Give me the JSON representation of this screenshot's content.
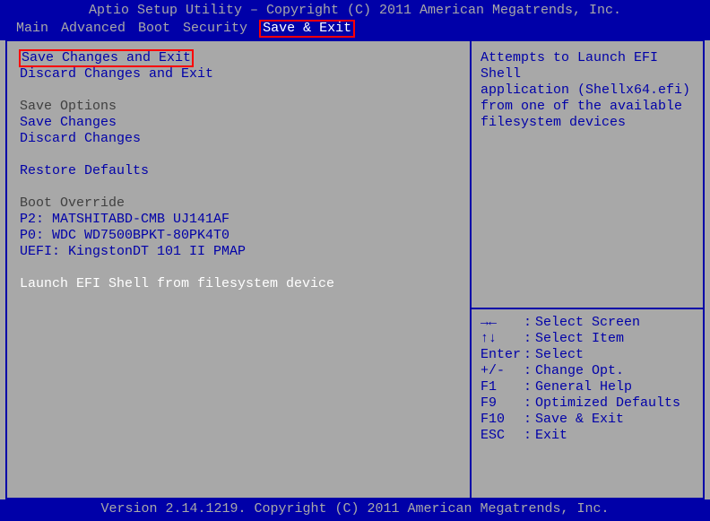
{
  "header": {
    "title": "Aptio Setup Utility – Copyright (C) 2011 American Megatrends, Inc.",
    "menu": {
      "main": "Main",
      "advanced": "Advanced",
      "boot": "Boot",
      "security": "Security",
      "save_exit": "Save & Exit"
    }
  },
  "footer": "Version 2.14.1219. Copyright (C) 2011 American Megatrends, Inc.",
  "left": {
    "save_changes_and_exit": "Save Changes and Exit",
    "discard_changes_and_exit": "Discard Changes and Exit",
    "save_options_heading": "Save Options",
    "save_changes": "Save Changes",
    "discard_changes": "Discard Changes",
    "restore_defaults": "Restore Defaults",
    "boot_override_heading": "Boot Override",
    "boot_items": [
      "P2: MATSHITABD-CMB UJ141AF",
      "P0: WDC WD7500BPKT-80PK4T0",
      "UEFI: KingstonDT 101 II PMAP"
    ],
    "launch_efi": "Launch EFI Shell from filesystem device"
  },
  "right_help": {
    "text_lines": [
      "Attempts to Launch EFI Shell",
      "application (Shellx64.efi)",
      "from one of the available",
      "filesystem devices"
    ]
  },
  "keymap": [
    {
      "key": "→←",
      "desc": "Select Screen"
    },
    {
      "key": "↑↓",
      "desc": "Select Item"
    },
    {
      "key": "Enter",
      "desc": "Select"
    },
    {
      "key": "+/-",
      "desc": "Change Opt."
    },
    {
      "key": "F1",
      "desc": "General Help"
    },
    {
      "key": "F9",
      "desc": "Optimized Defaults"
    },
    {
      "key": "F10",
      "desc": "Save & Exit"
    },
    {
      "key": "ESC",
      "desc": "Exit"
    }
  ]
}
